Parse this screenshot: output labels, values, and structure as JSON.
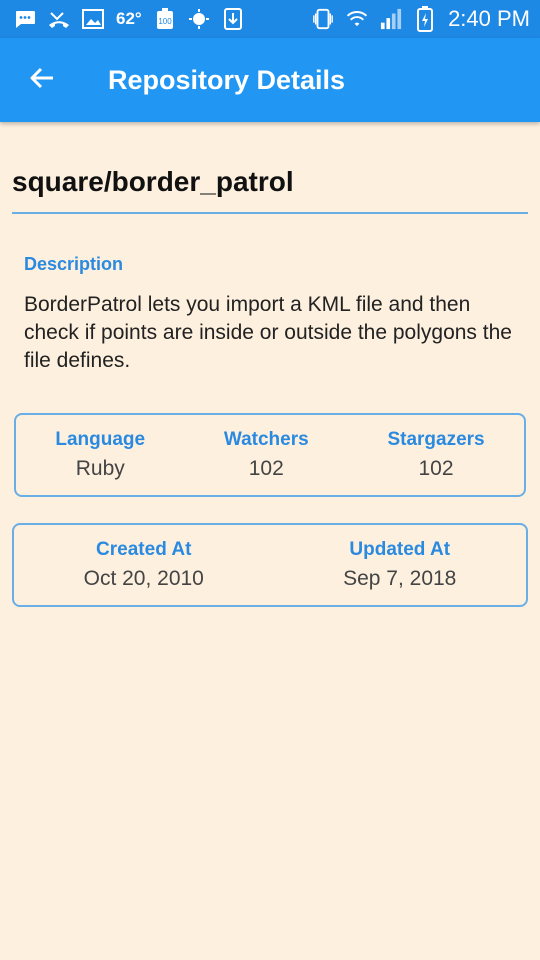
{
  "status_bar": {
    "temperature": "62°",
    "time": "2:40 PM",
    "icons": [
      "chat-icon",
      "missed-call-icon",
      "image-icon",
      "thermometer-icon",
      "battery-badge-icon",
      "brightness-icon",
      "download-icon",
      "vibrate-icon",
      "wifi-icon",
      "signal-icon",
      "battery-charging-icon"
    ]
  },
  "app_bar": {
    "title": "Repository Details",
    "back_icon": "arrow-back-icon"
  },
  "repo": {
    "name": "square/border_patrol",
    "description_label": "Description",
    "description": "BorderPatrol lets you import a KML file and then check if points are inside or outside the polygons the file defines."
  },
  "stats": {
    "language_label": "Language",
    "language": "Ruby",
    "watchers_label": "Watchers",
    "watchers": "102",
    "stargazers_label": "Stargazers",
    "stargazers": "102"
  },
  "dates": {
    "created_label": "Created At",
    "created": "Oct 20, 2010",
    "updated_label": "Updated At",
    "updated": "Sep 7, 2018"
  },
  "colors": {
    "status_bar": "#1e88e5",
    "app_bar": "#2196f3",
    "accent": "#2a8ae0",
    "background": "#fdf0df",
    "border": "#6aaee6"
  }
}
